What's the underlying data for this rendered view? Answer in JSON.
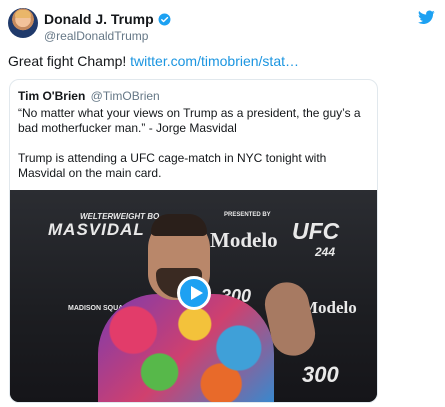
{
  "author": {
    "name": "Donald J. Trump",
    "handle": "@realDonaldTrump"
  },
  "tweet": {
    "text": "Great fight Champ! ",
    "link": "twitter.com/timobrien/stat…"
  },
  "quoted": {
    "name": "Tim O'Brien",
    "handle": "@TimOBrien",
    "paragraph1": "“No matter what your views on Trump as a president, the guy’s a bad motherfucker man.” - Jorge Masvidal",
    "paragraph2": "Trump is attending a UFC cage-match in NYC tonight with Masvidal on the main card."
  },
  "media": {
    "banner_top": "WELTERWEIGHT BO",
    "fighter_name": "MASVIDAL",
    "presented_by": "PRESENTED BY",
    "sponsor": "Modelo",
    "ufc": "UFC",
    "ufc_number": "244",
    "left_logo": "MADISON SQUARE",
    "bottom_right": "300",
    "right_sponsor": "Modelo"
  },
  "colors": {
    "link": "#1b95e0",
    "verified": "#1da1f2",
    "play_button": "#1da1f2"
  },
  "icons": [
    "verified-badge-icon",
    "twitter-bird-icon",
    "play-icon"
  ]
}
